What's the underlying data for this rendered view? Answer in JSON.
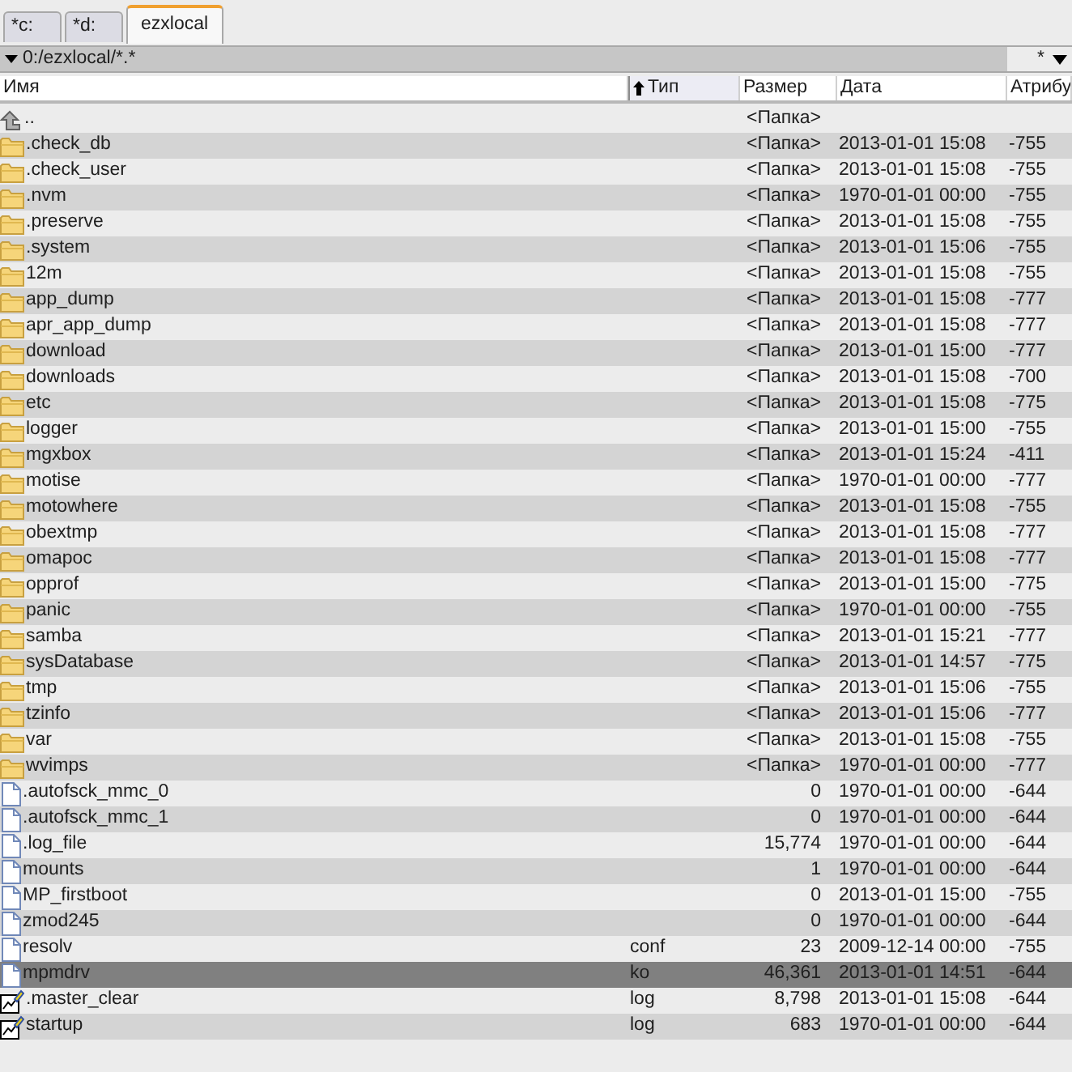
{
  "tabs": [
    {
      "label": "*c:",
      "selected": false
    },
    {
      "label": "*d:",
      "selected": false
    },
    {
      "label": "ezxlocal",
      "selected": true
    }
  ],
  "path_bar": {
    "path": "0:/ezxlocal/*.*",
    "filter": "*"
  },
  "columns": [
    {
      "label": "Имя",
      "sorted": false
    },
    {
      "label": "Тип",
      "sorted": true
    },
    {
      "label": "Размер",
      "sorted": false
    },
    {
      "label": "Дата",
      "sorted": false
    },
    {
      "label": "Атрибу",
      "sorted": false
    }
  ],
  "rows": [
    {
      "kind": "parent",
      "name": "..",
      "size": "<Папка>",
      "selected": false
    },
    {
      "kind": "folder",
      "name": ".check_db",
      "size": "<Папка>",
      "date": "2013-01-01 15:08",
      "attr": "-755",
      "selected": false
    },
    {
      "kind": "folder",
      "name": ".check_user",
      "size": "<Папка>",
      "date": "2013-01-01 15:08",
      "attr": "-755",
      "selected": false
    },
    {
      "kind": "folder",
      "name": ".nvm",
      "size": "<Папка>",
      "date": "1970-01-01 00:00",
      "attr": "-755",
      "selected": false
    },
    {
      "kind": "folder",
      "name": ".preserve",
      "size": "<Папка>",
      "date": "2013-01-01 15:08",
      "attr": "-755",
      "selected": false
    },
    {
      "kind": "folder",
      "name": ".system",
      "size": "<Папка>",
      "date": "2013-01-01 15:06",
      "attr": "-755",
      "selected": false
    },
    {
      "kind": "folder",
      "name": "12m",
      "size": "<Папка>",
      "date": "2013-01-01 15:08",
      "attr": "-755",
      "selected": false
    },
    {
      "kind": "folder",
      "name": "app_dump",
      "size": "<Папка>",
      "date": "2013-01-01 15:08",
      "attr": "-777",
      "selected": false
    },
    {
      "kind": "folder",
      "name": "apr_app_dump",
      "size": "<Папка>",
      "date": "2013-01-01 15:08",
      "attr": "-777",
      "selected": false
    },
    {
      "kind": "folder",
      "name": "download",
      "size": "<Папка>",
      "date": "2013-01-01 15:00",
      "attr": "-777",
      "selected": false
    },
    {
      "kind": "folder",
      "name": "downloads",
      "size": "<Папка>",
      "date": "2013-01-01 15:08",
      "attr": "-700",
      "selected": false
    },
    {
      "kind": "folder",
      "name": "etc",
      "size": "<Папка>",
      "date": "2013-01-01 15:08",
      "attr": "-775",
      "selected": false
    },
    {
      "kind": "folder",
      "name": "logger",
      "size": "<Папка>",
      "date": "2013-01-01 15:00",
      "attr": "-755",
      "selected": false
    },
    {
      "kind": "folder",
      "name": "mgxbox",
      "size": "<Папка>",
      "date": "2013-01-01 15:24",
      "attr": "-411",
      "selected": false
    },
    {
      "kind": "folder",
      "name": "motise",
      "size": "<Папка>",
      "date": "1970-01-01 00:00",
      "attr": "-777",
      "selected": false
    },
    {
      "kind": "folder",
      "name": "motowhere",
      "size": "<Папка>",
      "date": "2013-01-01 15:08",
      "attr": "-755",
      "selected": false
    },
    {
      "kind": "folder",
      "name": "obextmp",
      "size": "<Папка>",
      "date": "2013-01-01 15:08",
      "attr": "-777",
      "selected": false
    },
    {
      "kind": "folder",
      "name": "omapoc",
      "size": "<Папка>",
      "date": "2013-01-01 15:08",
      "attr": "-777",
      "selected": false
    },
    {
      "kind": "folder",
      "name": "opprof",
      "size": "<Папка>",
      "date": "2013-01-01 15:00",
      "attr": "-775",
      "selected": false
    },
    {
      "kind": "folder",
      "name": "panic",
      "size": "<Папка>",
      "date": "1970-01-01 00:00",
      "attr": "-755",
      "selected": false
    },
    {
      "kind": "folder",
      "name": "samba",
      "size": "<Папка>",
      "date": "2013-01-01 15:21",
      "attr": "-777",
      "selected": false
    },
    {
      "kind": "folder",
      "name": "sysDatabase",
      "size": "<Папка>",
      "date": "2013-01-01 14:57",
      "attr": "-775",
      "selected": false
    },
    {
      "kind": "folder",
      "name": "tmp",
      "size": "<Папка>",
      "date": "2013-01-01 15:06",
      "attr": "-755",
      "selected": false
    },
    {
      "kind": "folder",
      "name": "tzinfo",
      "size": "<Папка>",
      "date": "2013-01-01 15:06",
      "attr": "-777",
      "selected": false
    },
    {
      "kind": "folder",
      "name": "var",
      "size": "<Папка>",
      "date": "2013-01-01 15:08",
      "attr": "-755",
      "selected": false
    },
    {
      "kind": "folder",
      "name": "wvimps",
      "size": "<Папка>",
      "date": "1970-01-01 00:00",
      "attr": "-777",
      "selected": false
    },
    {
      "kind": "file",
      "name": ".autofsck_mmc_0",
      "size": "0",
      "date": "1970-01-01 00:00",
      "attr": "-644",
      "selected": false
    },
    {
      "kind": "file",
      "name": ".autofsck_mmc_1",
      "size": "0",
      "date": "1970-01-01 00:00",
      "attr": "-644",
      "selected": false
    },
    {
      "kind": "file",
      "name": ".log_file",
      "size": "15,774",
      "date": "1970-01-01 00:00",
      "attr": "-644",
      "selected": false
    },
    {
      "kind": "file",
      "name": "mounts",
      "size": "1",
      "date": "1970-01-01 00:00",
      "attr": "-644",
      "selected": false
    },
    {
      "kind": "file",
      "name": "MP_firstboot",
      "size": "0",
      "date": "2013-01-01 15:00",
      "attr": "-755",
      "selected": false
    },
    {
      "kind": "file",
      "name": "zmod245",
      "size": "0",
      "date": "1970-01-01 00:00",
      "attr": "-644",
      "selected": false
    },
    {
      "kind": "file",
      "name": "resolv",
      "type": "conf",
      "size": "23",
      "date": "2009-12-14 00:00",
      "attr": "-755",
      "selected": false
    },
    {
      "kind": "file",
      "name": "mpmdrv",
      "type": "ko",
      "size": "46,361",
      "date": "2013-01-01 14:51",
      "attr": "-644",
      "selected": true
    },
    {
      "kind": "log",
      "name": ".master_clear",
      "type": "log",
      "size": "8,798",
      "date": "2013-01-01 15:08",
      "attr": "-644",
      "selected": false
    },
    {
      "kind": "log",
      "name": "startup",
      "type": "log",
      "size": "683",
      "date": "1970-01-01 00:00",
      "attr": "-644",
      "selected": false
    }
  ]
}
